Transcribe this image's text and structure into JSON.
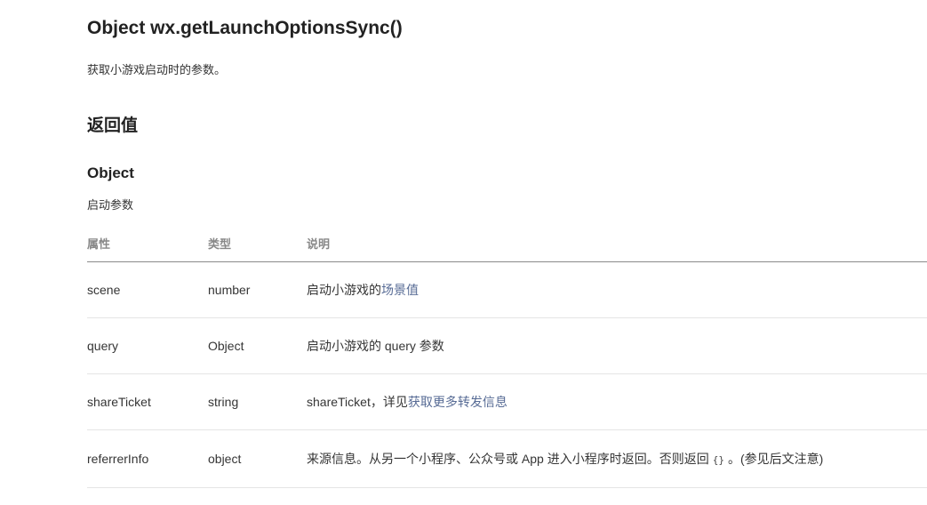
{
  "api": {
    "title": "Object wx.getLaunchOptionsSync()",
    "description": "获取小游戏启动时的参数。"
  },
  "return_section": {
    "title": "返回值",
    "object_title": "Object",
    "object_description": "启动参数"
  },
  "table": {
    "headers": [
      "属性",
      "类型",
      "说明"
    ],
    "rows": [
      {
        "property": "scene",
        "type": "number",
        "desc_prefix": "启动小游戏的",
        "desc_link": "场景值"
      },
      {
        "property": "query",
        "type": "Object",
        "desc": "启动小游戏的 query 参数"
      },
      {
        "property": "shareTicket",
        "type": "string",
        "desc_prefix": "shareTicket，详见",
        "desc_link": "获取更多转发信息"
      },
      {
        "property": "referrerInfo",
        "type": "object",
        "desc_prefix": "来源信息。从另一个小程序、公众号或 App 进入小程序时返回。否则返回",
        "desc_code": "{}",
        "desc_suffix": "。(参见后文注意)"
      }
    ]
  },
  "colors": {
    "link": "#576b95",
    "text": "#353535",
    "header_text": "#888888"
  }
}
